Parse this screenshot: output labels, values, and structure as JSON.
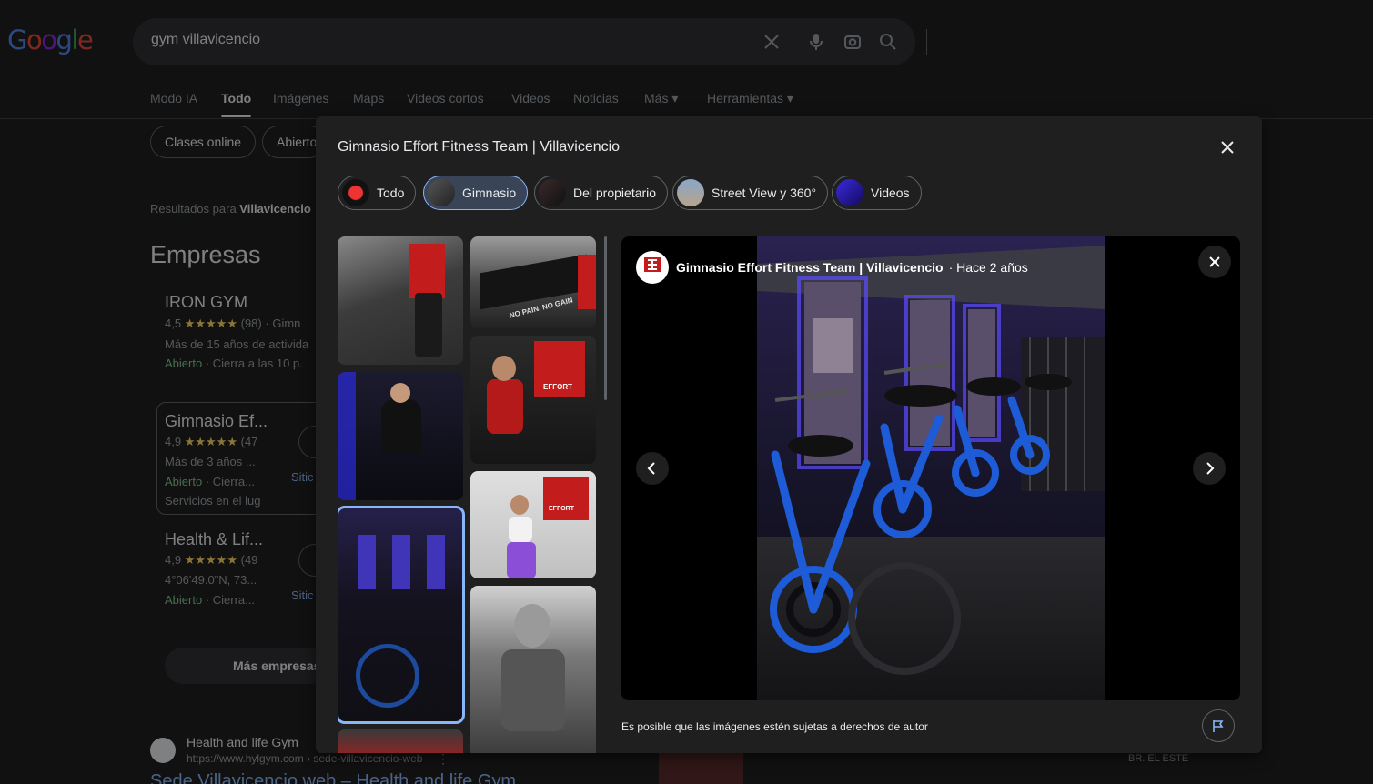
{
  "search": {
    "query": "gym villavicencio"
  },
  "logo": {
    "text": "Google"
  },
  "nav_tabs": [
    "Modo IA",
    "Todo",
    "Imágenes",
    "Maps",
    "Videos cortos",
    "Videos",
    "Noticias",
    "Más",
    "Herramientas"
  ],
  "chips": [
    "Clases online",
    "Abierto"
  ],
  "results_for": {
    "prefix": "Resultados para",
    "place": "Villavicencio"
  },
  "businesses": {
    "heading": "Empresas",
    "items": [
      {
        "name": "IRON GYM",
        "rating": "4,5",
        "reviews": "(98)",
        "type": "Gimn",
        "desc": "Más de 15 años de activida",
        "status": "Abierto",
        "hours": "· Cierra a las 10 p."
      },
      {
        "name": "Gimnasio Ef...",
        "rating": "4,9",
        "reviews": "(47",
        "desc": "Más de 3 años ...",
        "status": "Abierto",
        "hours": "· Cierra...",
        "extra": "Servicios en el lug",
        "site": "Sitic"
      },
      {
        "name": "Health & Lif...",
        "rating": "4,9",
        "reviews": "(49",
        "desc": "4°06'49.0\"N, 73...",
        "status": "Abierto",
        "hours": "· Cierra...",
        "site": "Sitic"
      }
    ],
    "more": "Más empresas"
  },
  "web_result": {
    "site_name": "Health and life Gym",
    "url": "https://www.hylgym.com › sede-villavicencio-web",
    "title": "Sede Villavicencio web – Health and life Gym",
    "thumb_text": "BR. EL ESTE"
  },
  "modal": {
    "title": "Gimnasio Effort Fitness Team | Villavicencio",
    "categories": [
      "Todo",
      "Gimnasio",
      "Del propietario",
      "Street View y 360°",
      "Videos"
    ],
    "selected_category": "Gimnasio",
    "source_name": "Gimnasio Effort Fitness Team | Villavicencio",
    "source_time": "· Hace 2 años",
    "logo_text": "EFFORT",
    "thumb_texts": {
      "t2": "NO PAIN, NO GAIN",
      "t3": "EFFORT",
      "t5": "EFFORT"
    },
    "copyright": "Es posible que las imágenes estén sujetas a derechos de autor"
  },
  "colors": {
    "accent": "#8ab4f8",
    "open_green": "#81c995",
    "star": "#fdd663",
    "bg": "#1f1f1f"
  }
}
